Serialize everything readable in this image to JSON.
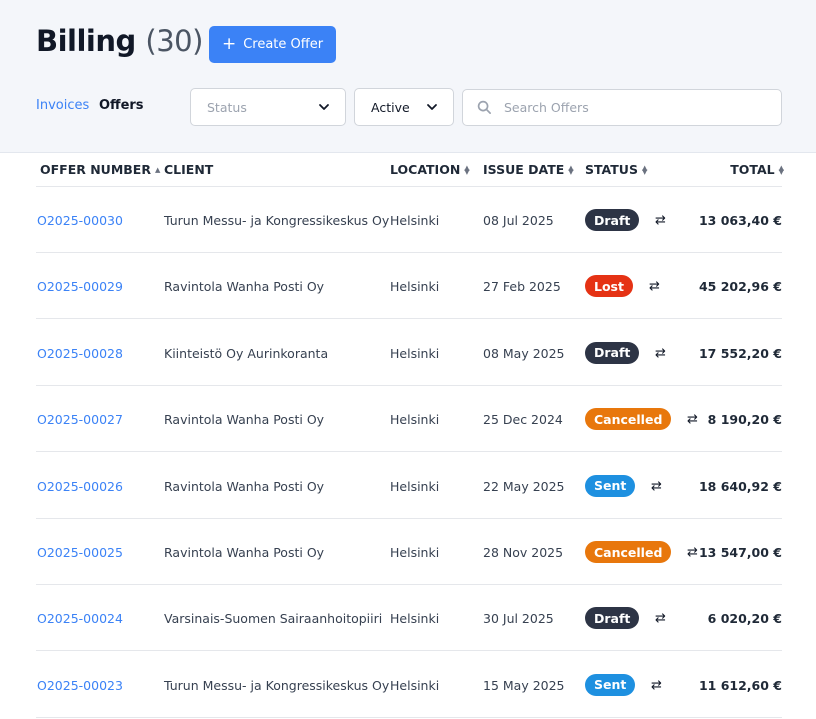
{
  "page": {
    "title": "Billing",
    "count": "(30)"
  },
  "toolbar": {
    "create_label": "Create Offer"
  },
  "tabs": [
    {
      "label": "Invoices"
    },
    {
      "label": "Offers"
    }
  ],
  "filters": {
    "status": {
      "placeholder": "Status"
    },
    "active": {
      "value": "Active"
    },
    "search": {
      "placeholder": "Search Offers"
    }
  },
  "columns": {
    "offer_number": "OFFER NUMBER",
    "client": "CLIENT",
    "location": "LOCATION",
    "issue_date": "ISSUE DATE",
    "status": "STATUS",
    "total": "TOTAL"
  },
  "status_colors": {
    "Draft": "#2d3445",
    "Lost": "#e53214",
    "Cancelled": "#e8770c",
    "Sent": "#1e90e0"
  },
  "rows": [
    {
      "offer_number": "O2025-00030",
      "client": "Turun Messu- ja Kongressikeskus Oy",
      "location": "Helsinki",
      "issue_date": "08 Jul 2025",
      "status": "Draft",
      "total": "13 063,40 €"
    },
    {
      "offer_number": "O2025-00029",
      "client": "Ravintola Wanha Posti Oy",
      "location": "Helsinki",
      "issue_date": "27 Feb 2025",
      "status": "Lost",
      "total": "45 202,96 €"
    },
    {
      "offer_number": "O2025-00028",
      "client": "Kiinteistö Oy Aurinkoranta",
      "location": "Helsinki",
      "issue_date": "08 May 2025",
      "status": "Draft",
      "total": "17 552,20 €"
    },
    {
      "offer_number": "O2025-00027",
      "client": "Ravintola Wanha Posti Oy",
      "location": "Helsinki",
      "issue_date": "25 Dec 2024",
      "status": "Cancelled",
      "total": "8 190,20 €"
    },
    {
      "offer_number": "O2025-00026",
      "client": "Ravintola Wanha Posti Oy",
      "location": "Helsinki",
      "issue_date": "22 May 2025",
      "status": "Sent",
      "total": "18 640,92 €"
    },
    {
      "offer_number": "O2025-00025",
      "client": "Ravintola Wanha Posti Oy",
      "location": "Helsinki",
      "issue_date": "28 Nov 2025",
      "status": "Cancelled",
      "total": "13 547,00 €"
    },
    {
      "offer_number": "O2025-00024",
      "client": "Varsinais-Suomen Sairaanhoitopiiri",
      "location": "Helsinki",
      "issue_date": "30 Jul 2025",
      "status": "Draft",
      "total": "6 020,20 €"
    },
    {
      "offer_number": "O2025-00023",
      "client": "Turun Messu- ja Kongressikeskus Oy",
      "location": "Helsinki",
      "issue_date": "15 May 2025",
      "status": "Sent",
      "total": "11 612,60 €"
    }
  ]
}
